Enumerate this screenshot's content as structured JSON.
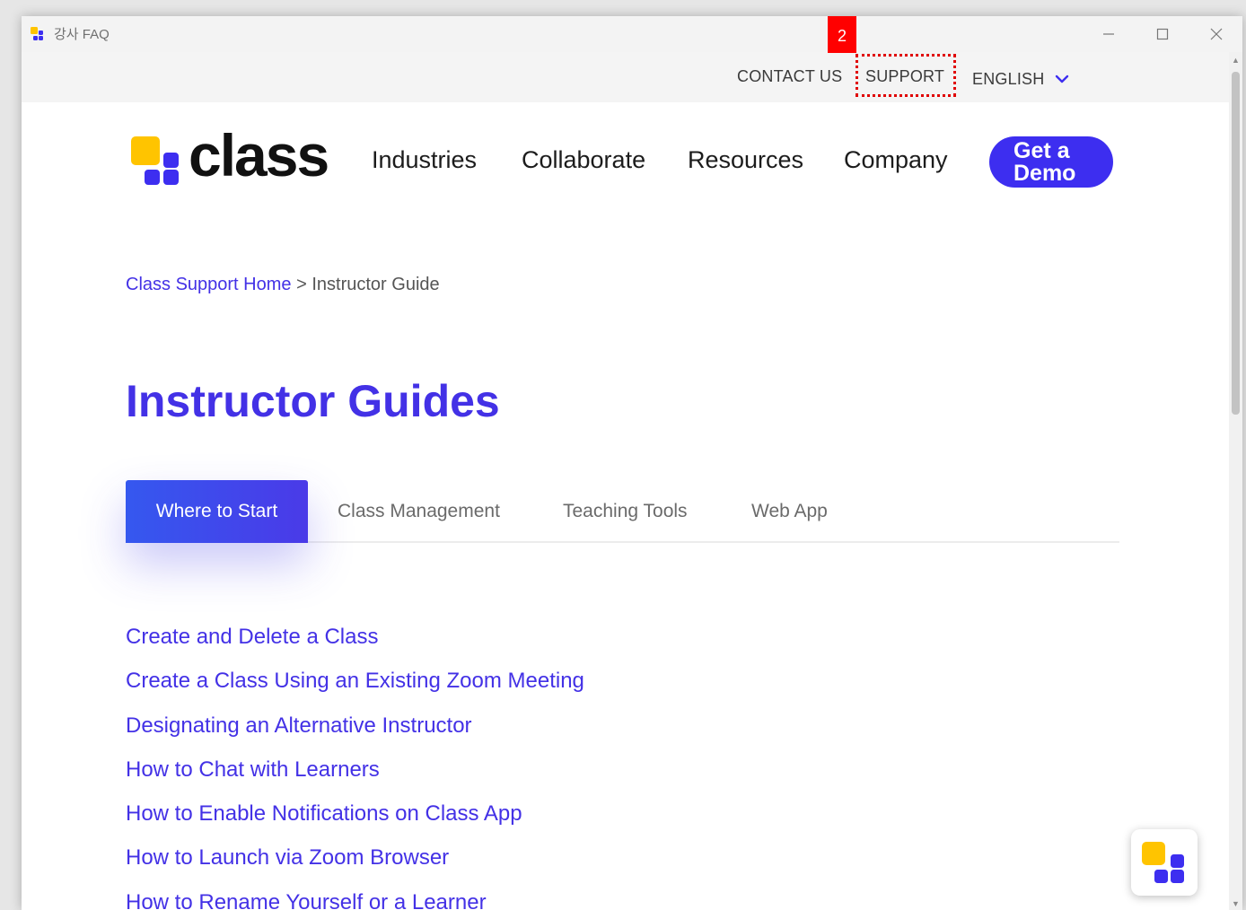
{
  "window": {
    "title": "강사 FAQ",
    "controls": [
      "minimize",
      "maximize",
      "close"
    ]
  },
  "annotation": {
    "marker_label": "2"
  },
  "topbar": {
    "contact_label": "CONTACT US",
    "support_label": "SUPPORT",
    "language_label": "ENGLISH"
  },
  "header": {
    "logo_text": "class",
    "nav": [
      "Industries",
      "Collaborate",
      "Resources",
      "Company"
    ],
    "demo_line1": "Get a",
    "demo_line2": "Demo"
  },
  "breadcrumb": {
    "home": "Class Support Home",
    "separator": ">",
    "current": "Instructor Guide"
  },
  "page_title": "Instructor Guides",
  "tabs": [
    "Where to Start",
    "Class Management",
    "Teaching Tools",
    "Web App"
  ],
  "guides": [
    "Create and Delete a Class",
    "Create a Class Using an Existing Zoom Meeting",
    "Designating an Alternative Instructor",
    "How to Chat with Learners",
    "How to Enable Notifications on Class App",
    "How to Launch via Zoom Browser",
    "How to Rename Yourself or a Learner"
  ],
  "colors": {
    "accent": "#4331e6",
    "logo_yellow": "#ffc400",
    "logo_purple": "#3d2ef0",
    "annotation_red": "#ff0000"
  }
}
